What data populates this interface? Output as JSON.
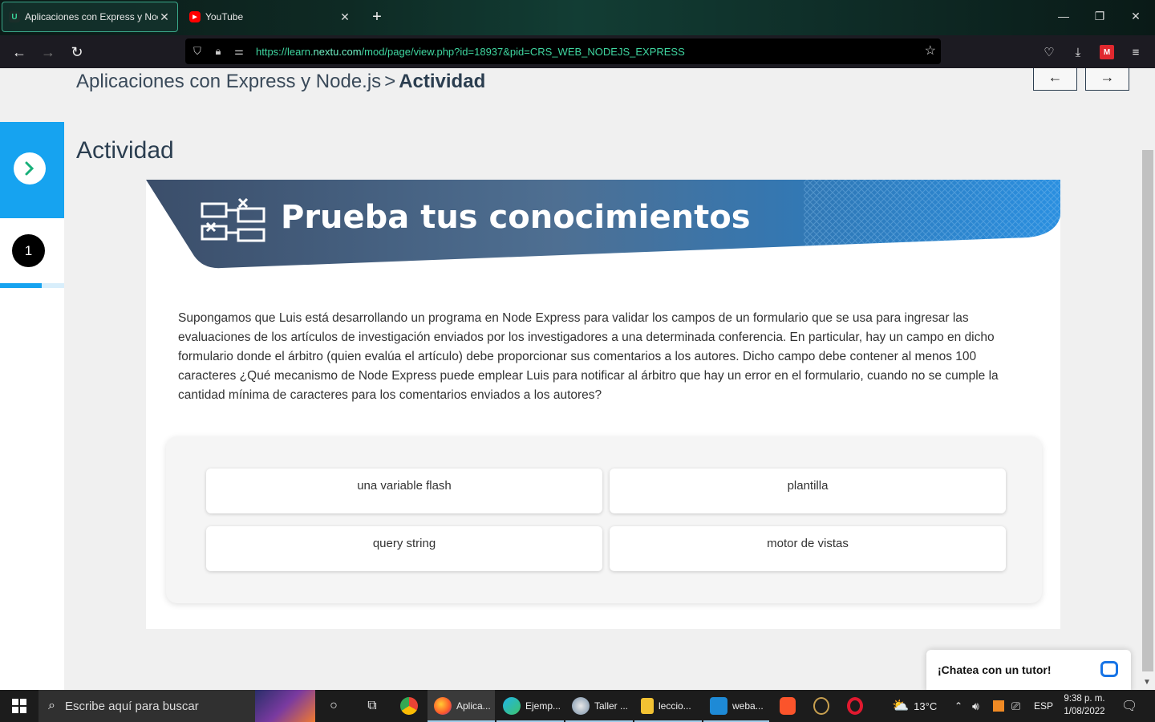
{
  "browser": {
    "tabs": [
      {
        "title": "Aplicaciones con Express y Node.js",
        "active": true
      },
      {
        "title": "YouTube",
        "active": false
      }
    ],
    "url_prefix": "https://learn.",
    "url_domain": "nextu.com",
    "url_path": "/mod/page/view.php?id=18937&pid=CRS_WEB_NODEJS_EXPRESS"
  },
  "page": {
    "breadcrumb": {
      "course": "Aplicaciones con Express y Node.js",
      "separator": ">",
      "current": "Actividad"
    },
    "nav": {
      "prev": "←",
      "next": "→"
    },
    "sidebar": {
      "toggle": "›",
      "step": "1"
    },
    "heading": "Actividad",
    "banner_title": "Prueba tus conocimientos",
    "question": "Supongamos que Luis está desarrollando un programa en Node Express para validar los campos de un formulario que se usa para ingresar las evaluaciones de los artículos de investigación enviados por los investigadores a una determinada conferencia. En particular, hay un campo en dicho formulario donde el árbitro (quien evalúa el artículo) debe proporcionar sus comentarios a los autores. Dicho campo debe contener al menos 100 caracteres ¿Qué mecanismo de Node Express puede emplear Luis para notificar al árbitro que hay un error en el formulario, cuando no se cumple la cantidad mínima de caracteres para los comentarios enviados a los autores?",
    "answers": [
      "una variable flash",
      "plantilla",
      "query string",
      "motor de vistas"
    ],
    "chat_label": "¡Chatea con un tutor!"
  },
  "taskbar": {
    "search_placeholder": "Escribe aquí para buscar",
    "apps": [
      "Aplica...",
      "Ejemp...",
      "Taller ...",
      "leccio...",
      "weba..."
    ],
    "weather": "13°C",
    "lang": "ESP",
    "time": "9:38 p. m.",
    "date": "1/08/2022"
  },
  "colors": {
    "accent_blue": "#16a3f0",
    "banner_dark": "#2f4a6a",
    "url_green": "#3fd6a0"
  }
}
